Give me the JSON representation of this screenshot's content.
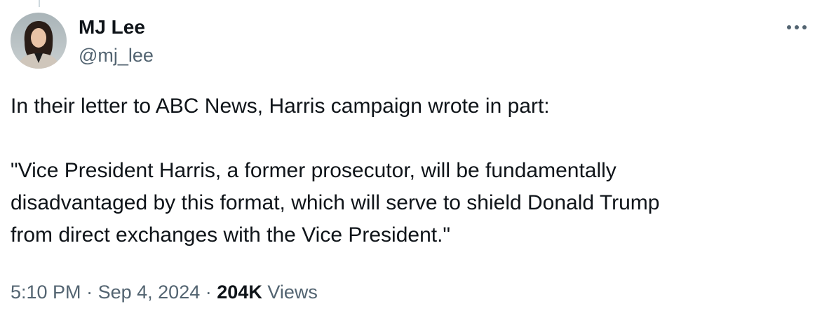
{
  "author": {
    "display_name": "MJ Lee",
    "handle": "@mj_lee",
    "avatar_icon": "profile-photo"
  },
  "more_icon": "more-horizontal-icon",
  "tweet": {
    "line1": "In their letter to ABC News, Harris campaign wrote in part:",
    "quote_line1": "\"Vice President Harris, a former prosecutor, will be fundamentally",
    "quote_line2": "disadvantaged by this format, which will serve to shield Donald Trump",
    "quote_line3": "from direct exchanges with the Vice President.\""
  },
  "meta": {
    "time": "5:10 PM",
    "separator": "·",
    "date": "Sep 4, 2024",
    "views_count": "204K",
    "views_label": "Views"
  },
  "colors": {
    "text_primary": "#0f1419",
    "text_secondary": "#536471",
    "background": "#ffffff"
  }
}
